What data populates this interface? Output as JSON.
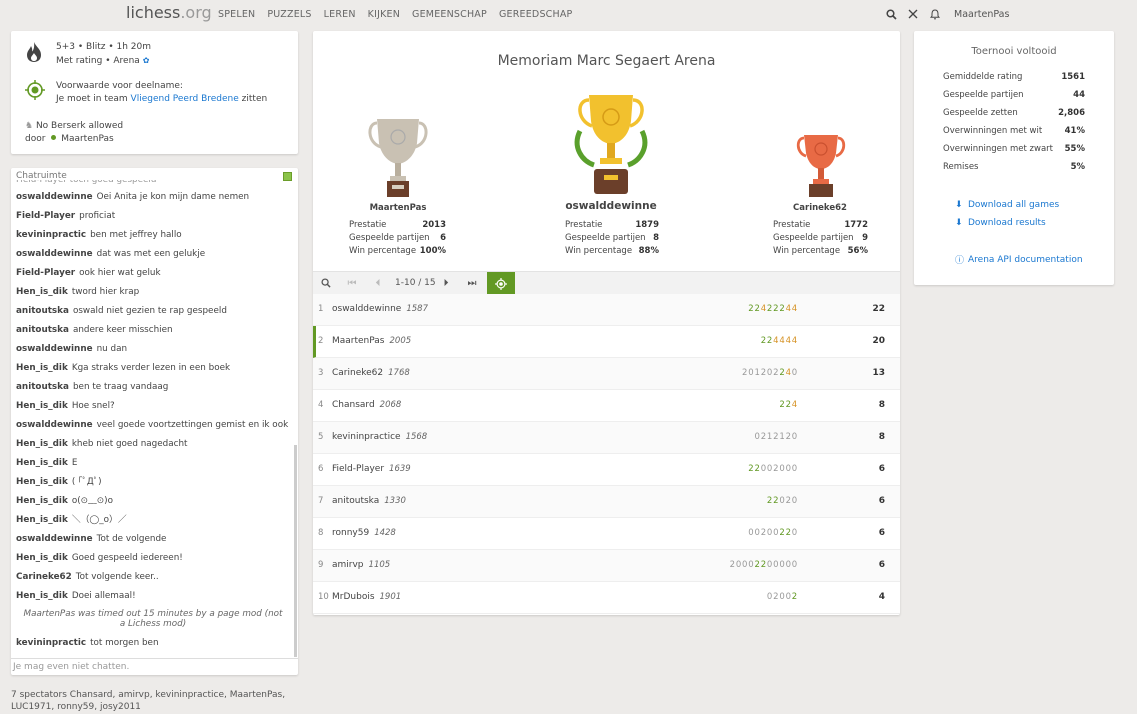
{
  "nav": {
    "logo_main": "lichess",
    "logo_tld": ".org",
    "links": [
      "SPELEN",
      "PUZZELS",
      "LEREN",
      "KIJKEN",
      "GEMEENSCHAP",
      "GEREEDSCHAP"
    ],
    "icons": [
      "search-icon",
      "close-icon",
      "bell-icon"
    ],
    "user": "MaartenPas"
  },
  "info": {
    "line1": "5+3 • Blitz • 1h 20m",
    "line2": "Met rating • Arena",
    "condition_title": "Voorwaarde voor deelname:",
    "condition_prefix": "Je moet in team",
    "condition_team": "Vliegend Peerd Bredene",
    "condition_suffix": "zitten",
    "berserk": "No Berserk allowed",
    "by_label": "door",
    "by_user": "MaartenPas"
  },
  "chat": {
    "header": "Chatruimte",
    "partial_top": "Field-Player  toch goed gespeeld",
    "messages": [
      {
        "user": "oswalddewinne",
        "text": "Oei Anita je kon mijn dame nemen"
      },
      {
        "user": "Field-Player",
        "text": "proficiat"
      },
      {
        "user": "kevininpractic",
        "text": "ben met jeffrey hallo"
      },
      {
        "user": "oswalddewinne",
        "text": "dat was met een gelukje"
      },
      {
        "user": "Field-Player",
        "text": "ook hier wat geluk"
      },
      {
        "user": "Hen_is_dik",
        "text": "tword hier krap"
      },
      {
        "user": "anitoutska",
        "text": "oswald niet gezien te rap gespeeld"
      },
      {
        "user": "anitoutska",
        "text": "andere keer misschien"
      },
      {
        "user": "oswalddewinne",
        "text": "nu dan"
      },
      {
        "user": "Hen_is_dik",
        "text": "Kga straks verder lezen in een boek"
      },
      {
        "user": "anitoutska",
        "text": "ben te traag vandaag"
      },
      {
        "user": "Hen_is_dik",
        "text": "Hoe snel?"
      },
      {
        "user": "oswalddewinne",
        "text": "veel goede voortzettingen gemist en ik ook"
      },
      {
        "user": "Hen_is_dik",
        "text": "kheb niet goed nagedacht"
      },
      {
        "user": "Hen_is_dik",
        "text": "E"
      },
      {
        "user": "Hen_is_dik",
        "text": "( ｢ﾟДﾟ)"
      },
      {
        "user": "Hen_is_dik",
        "text": "o(⊙﹏⊙)o"
      },
      {
        "user": "Hen_is_dik",
        "text": "＼（◯_o）／"
      },
      {
        "user": "oswalddewinne",
        "text": "Tot de volgende"
      },
      {
        "user": "Hen_is_dik",
        "text": "Goed gespeeld iedereen!"
      },
      {
        "user": "Carineke62",
        "text": "Tot volgende keer.."
      },
      {
        "user": "Hen_is_dik",
        "text": "Doei allemaal!"
      }
    ],
    "system": "MaartenPas was timed out 15 minutes by a page mod (not a Lichess mod)",
    "last": {
      "user": "kevininpractic",
      "text": "tot morgen ben"
    },
    "input_placeholder": "Je mag even niet chatten."
  },
  "spectators": "7 spectators Chansard, amirvp, kevininpractice, MaartenPas, LUC1971, ronny59, josy2011",
  "tournament": {
    "title": "Memoriam Marc Segaert Arena",
    "stat_labels": [
      "Prestatie",
      "Gespeelde partijen",
      "Win percentage"
    ],
    "podium": [
      {
        "place": 2,
        "name": "MaartenPas",
        "perf": "2013",
        "games": "6",
        "win": "100%"
      },
      {
        "place": 1,
        "name": "oswalddewinne",
        "perf": "1879",
        "games": "8",
        "win": "88%"
      },
      {
        "place": 3,
        "name": "Carineke62",
        "perf": "1772",
        "games": "9",
        "win": "56%"
      }
    ],
    "pager": "1-10 / 15",
    "standings": [
      {
        "rank": "1",
        "name": "oswalddewinne",
        "rating": "1587",
        "sheet": [
          [
            "2",
            "d"
          ],
          [
            "2",
            "d"
          ],
          [
            "4",
            "o"
          ],
          [
            "2",
            "d"
          ],
          [
            "2",
            "d"
          ],
          [
            "2",
            "d"
          ],
          [
            "4",
            "o"
          ],
          [
            "4",
            "o"
          ]
        ],
        "score": "22"
      },
      {
        "rank": "2",
        "name": "MaartenPas",
        "rating": "2005",
        "sheet": [
          [
            "2",
            "d"
          ],
          [
            "2",
            "d"
          ],
          [
            "4",
            "o"
          ],
          [
            "4",
            "o"
          ],
          [
            "4",
            "o"
          ],
          [
            "4",
            "o"
          ]
        ],
        "score": "20",
        "me": true
      },
      {
        "rank": "3",
        "name": "Carineke62",
        "rating": "1768",
        "sheet": [
          [
            "2",
            ""
          ],
          [
            "0",
            ""
          ],
          [
            "1",
            ""
          ],
          [
            "2",
            ""
          ],
          [
            "0",
            ""
          ],
          [
            "2",
            ""
          ],
          [
            "2",
            "d"
          ],
          [
            "4",
            "o"
          ],
          [
            "0",
            ""
          ]
        ],
        "score": "13"
      },
      {
        "rank": "4",
        "name": "Chansard",
        "rating": "2068",
        "sheet": [
          [
            "2",
            "d"
          ],
          [
            "2",
            "d"
          ],
          [
            "4",
            "o"
          ]
        ],
        "score": "8"
      },
      {
        "rank": "5",
        "name": "kevininpractice",
        "rating": "1568",
        "sheet": [
          [
            "0",
            ""
          ],
          [
            "2",
            ""
          ],
          [
            "1",
            ""
          ],
          [
            "2",
            ""
          ],
          [
            "1",
            ""
          ],
          [
            "2",
            ""
          ],
          [
            "0",
            ""
          ]
        ],
        "score": "8"
      },
      {
        "rank": "6",
        "name": "Field-Player",
        "rating": "1639",
        "sheet": [
          [
            "2",
            "d"
          ],
          [
            "2",
            "d"
          ],
          [
            "0",
            ""
          ],
          [
            "0",
            ""
          ],
          [
            "2",
            ""
          ],
          [
            "0",
            ""
          ],
          [
            "0",
            ""
          ],
          [
            "0",
            ""
          ]
        ],
        "score": "6"
      },
      {
        "rank": "7",
        "name": "anitoutska",
        "rating": "1330",
        "sheet": [
          [
            "2",
            "d"
          ],
          [
            "2",
            "d"
          ],
          [
            "0",
            ""
          ],
          [
            "2",
            ""
          ],
          [
            "0",
            ""
          ]
        ],
        "score": "6"
      },
      {
        "rank": "8",
        "name": "ronny59",
        "rating": "1428",
        "sheet": [
          [
            "0",
            ""
          ],
          [
            "0",
            ""
          ],
          [
            "2",
            ""
          ],
          [
            "0",
            ""
          ],
          [
            "0",
            ""
          ],
          [
            "2",
            "d"
          ],
          [
            "2",
            "d"
          ],
          [
            "0",
            ""
          ]
        ],
        "score": "6"
      },
      {
        "rank": "9",
        "name": "amirvp",
        "rating": "1105",
        "sheet": [
          [
            "2",
            ""
          ],
          [
            "0",
            ""
          ],
          [
            "0",
            ""
          ],
          [
            "0",
            ""
          ],
          [
            "2",
            "d"
          ],
          [
            "2",
            "d"
          ],
          [
            "0",
            ""
          ],
          [
            "0",
            ""
          ],
          [
            "0",
            ""
          ],
          [
            "0",
            ""
          ],
          [
            "0",
            ""
          ]
        ],
        "score": "6"
      },
      {
        "rank": "10",
        "name": "MrDubois",
        "rating": "1901",
        "sheet": [
          [
            "0",
            ""
          ],
          [
            "2",
            ""
          ],
          [
            "0",
            ""
          ],
          [
            "0",
            ""
          ],
          [
            "2",
            "d"
          ]
        ],
        "score": "4"
      }
    ]
  },
  "summary": {
    "title": "Toernooi voltooid",
    "stats": [
      {
        "label": "Gemiddelde rating",
        "value": "1561"
      },
      {
        "label": "Gespeelde partijen",
        "value": "44"
      },
      {
        "label": "Gespeelde zetten",
        "value": "2,806"
      },
      {
        "label": "Overwinningen met wit",
        "value": "41%"
      },
      {
        "label": "Overwinningen met zwart",
        "value": "55%"
      },
      {
        "label": "Remises",
        "value": "5%"
      }
    ],
    "links": [
      "Download all games",
      "Download results",
      "Arena API documentation"
    ]
  }
}
